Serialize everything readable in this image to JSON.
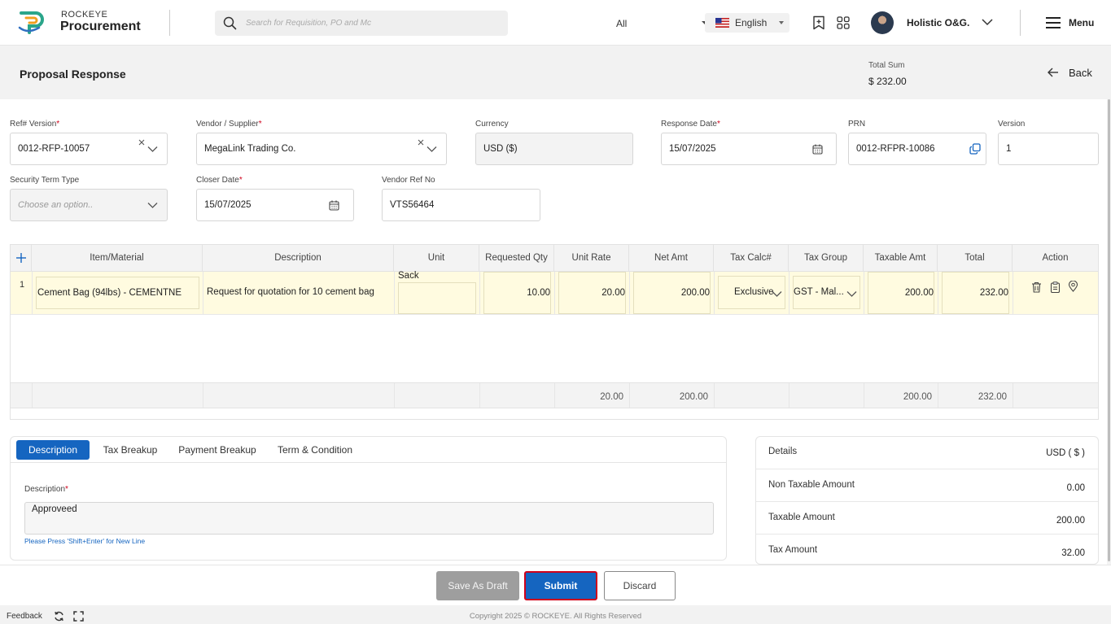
{
  "header": {
    "brand_top": "ROCKEYE",
    "brand_main": "Procurement",
    "search_placeholder": "Search for Requisition, PO and Mc",
    "search_scope": "All",
    "language": "English",
    "user_name": "Holistic O&G.",
    "menu_label": "Menu"
  },
  "title_band": {
    "title": "Proposal Response",
    "total_label": "Total Sum",
    "total_value": "$ 232.00",
    "back_label": "Back"
  },
  "form": {
    "ref_version": {
      "label": "Ref# Version",
      "value": "0012-RFP-10057"
    },
    "vendor": {
      "label": "Vendor / Supplier",
      "value": "MegaLink Trading Co."
    },
    "currency": {
      "label": "Currency",
      "value": "USD ($)"
    },
    "response_date": {
      "label": "Response Date",
      "value": "15/07/2025"
    },
    "prn": {
      "label": "PRN",
      "value": "0012-RFPR-10086"
    },
    "version": {
      "label": "Version",
      "value": "1"
    },
    "security_term": {
      "label": "Security Term Type",
      "placeholder": "Choose an option.."
    },
    "closer_date": {
      "label": "Closer Date",
      "value": "15/07/2025"
    },
    "vendor_ref": {
      "label": "Vendor Ref No",
      "value": "VTS56464"
    }
  },
  "grid": {
    "columns": [
      "Item/Material",
      "Description",
      "Unit",
      "Requested Qty",
      "Unit Rate",
      "Net Amt",
      "Tax Calc#",
      "Tax Group",
      "Taxable Amt",
      "Total",
      "Action"
    ],
    "rows": [
      {
        "index": "1",
        "item": "Cement Bag (94lbs) - CEMENTNE",
        "description": "Request for quotation for 10 cement bag",
        "unit": "Sack",
        "requested_qty": "10.00",
        "unit_rate": "20.00",
        "net_amt": "200.00",
        "tax_calc": "Exclusive",
        "tax_group": "GST - Mal...",
        "taxable_amt": "200.00",
        "total": "232.00"
      }
    ],
    "footer": {
      "unit_rate": "20.00",
      "net_amt": "200.00",
      "taxable_amt": "200.00",
      "total": "232.00"
    }
  },
  "tabs": {
    "items": [
      "Description",
      "Tax Breakup",
      "Payment Breakup",
      "Term & Condition"
    ],
    "description_label": "Description",
    "description_value": "Approveed",
    "hint": "Please Press 'Shift+Enter' for New Line"
  },
  "details": {
    "title": "Details",
    "currency": "USD ( $ )",
    "rows": [
      {
        "label": "Non Taxable Amount",
        "value": "0.00"
      },
      {
        "label": "Taxable Amount",
        "value": "200.00"
      },
      {
        "label": "Tax Amount",
        "value": "32.00"
      }
    ]
  },
  "actions": {
    "save_draft": "Save As Draft",
    "submit": "Submit",
    "discard": "Discard"
  },
  "footer": {
    "feedback": "Feedback",
    "copyright": "Copyright 2025 © ROCKEYE. All Rights Reserved"
  },
  "colors": {
    "primary": "#1565c0",
    "highlight_border": "#d0021b",
    "row_highlight": "#fffbe0"
  }
}
